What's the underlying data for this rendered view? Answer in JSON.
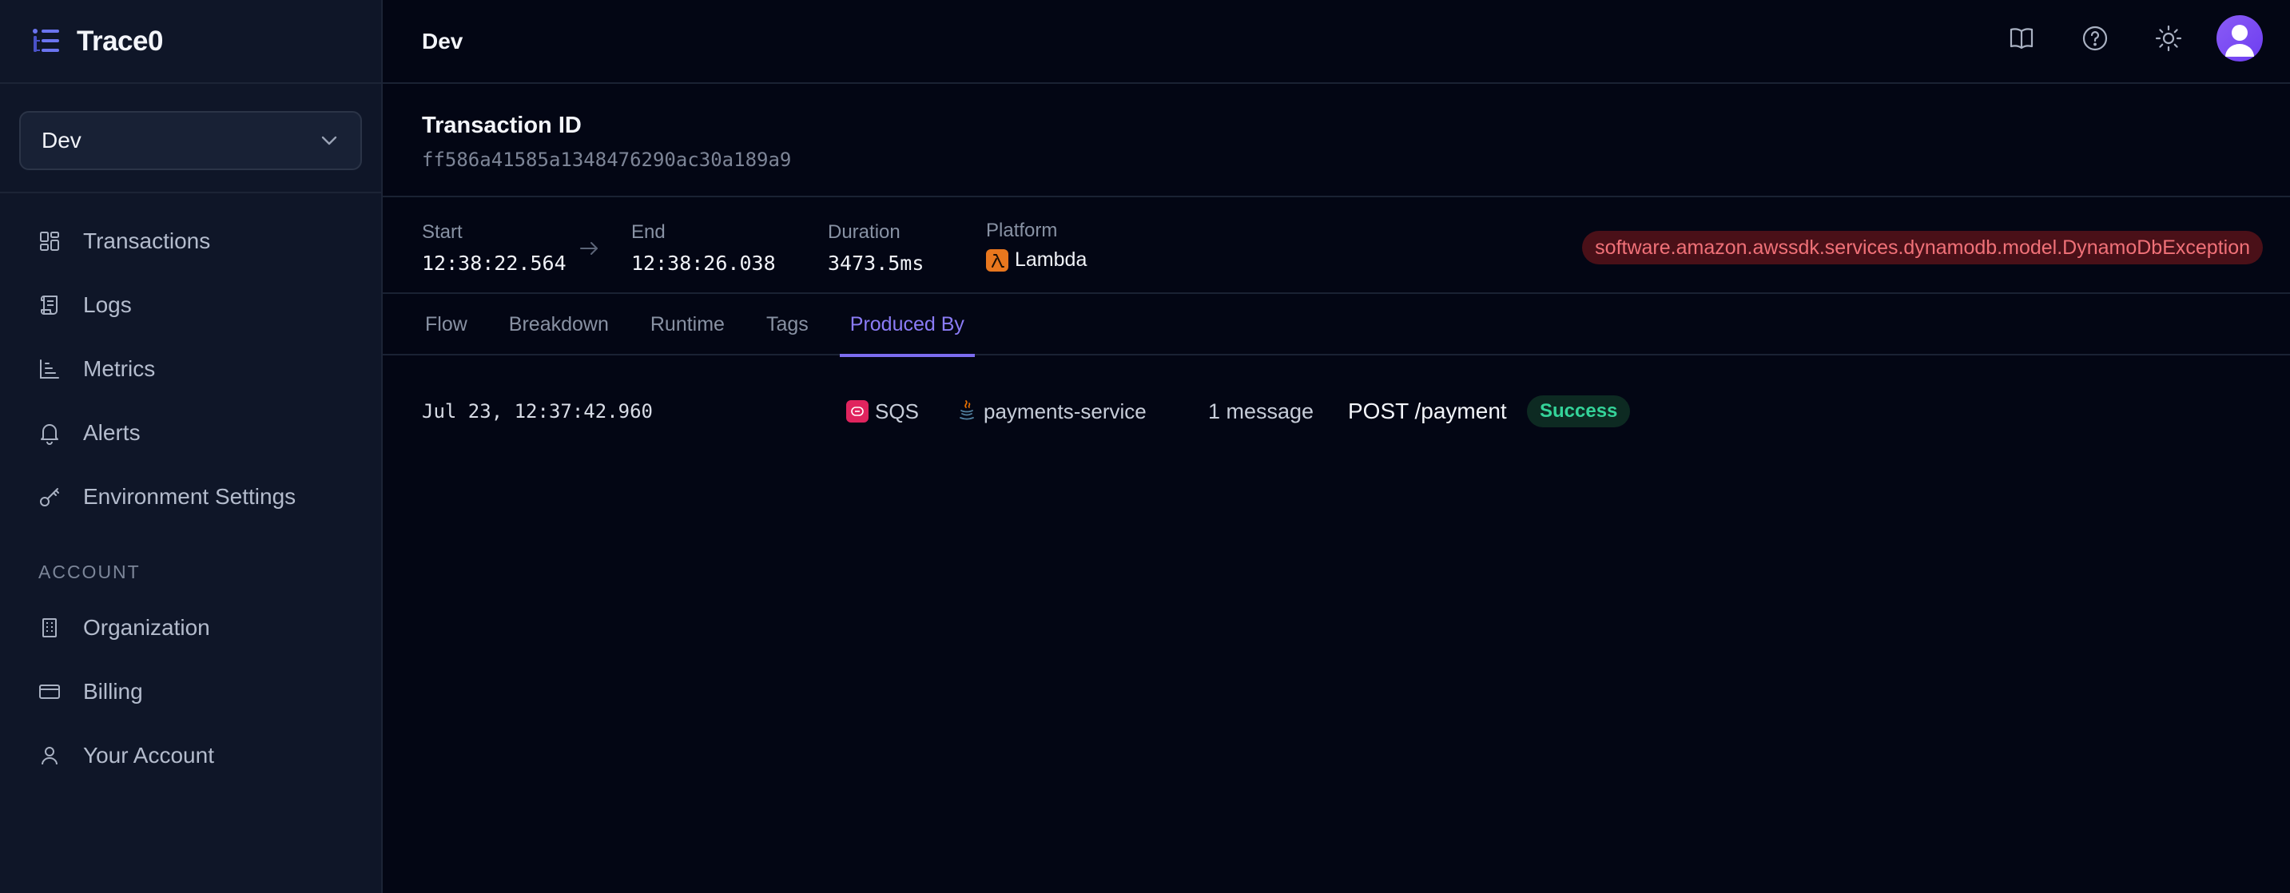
{
  "sidebar": {
    "brand": "Trace0",
    "environment": "Dev",
    "nav": [
      {
        "label": "Transactions",
        "icon": "dashboard-grid-icon"
      },
      {
        "label": "Logs",
        "icon": "scroll-icon"
      },
      {
        "label": "Metrics",
        "icon": "bar-chart-icon"
      },
      {
        "label": "Alerts",
        "icon": "bell-icon"
      },
      {
        "label": "Environment Settings",
        "icon": "key-icon"
      }
    ],
    "account_heading": "ACCOUNT",
    "account": [
      {
        "label": "Organization",
        "icon": "building-icon"
      },
      {
        "label": "Billing",
        "icon": "credit-card-icon"
      },
      {
        "label": "Your Account",
        "icon": "user-icon"
      }
    ]
  },
  "header": {
    "title": "Dev",
    "icons": [
      "book-icon",
      "help-icon",
      "sun-icon",
      "avatar"
    ]
  },
  "transaction": {
    "label": "Transaction ID",
    "id": "ff586a41585a1348476290ac30a189a9"
  },
  "meta": {
    "start_label": "Start",
    "start_value": "12:38:22.564",
    "end_label": "End",
    "end_value": "12:38:26.038",
    "duration_label": "Duration",
    "duration_value": "3473.5ms",
    "platform_label": "Platform",
    "platform_value": "Lambda",
    "exception": "software.amazon.awssdk.services.dynamodb.model.DynamoDbException"
  },
  "tabs": [
    {
      "label": "Flow"
    },
    {
      "label": "Breakdown"
    },
    {
      "label": "Runtime"
    },
    {
      "label": "Tags"
    },
    {
      "label": "Produced By"
    }
  ],
  "active_tab": "Produced By",
  "rows": [
    {
      "timestamp": "Jul 23, 12:37:42.960",
      "source": "SQS",
      "service": "payments-service",
      "count": "1 message",
      "route": "POST /payment",
      "status": "Success"
    }
  ],
  "colors": {
    "accent": "#7c6cf0",
    "background": "#030614",
    "sidebar": "#0f1628",
    "error": "#f07178",
    "success": "#34d399"
  }
}
